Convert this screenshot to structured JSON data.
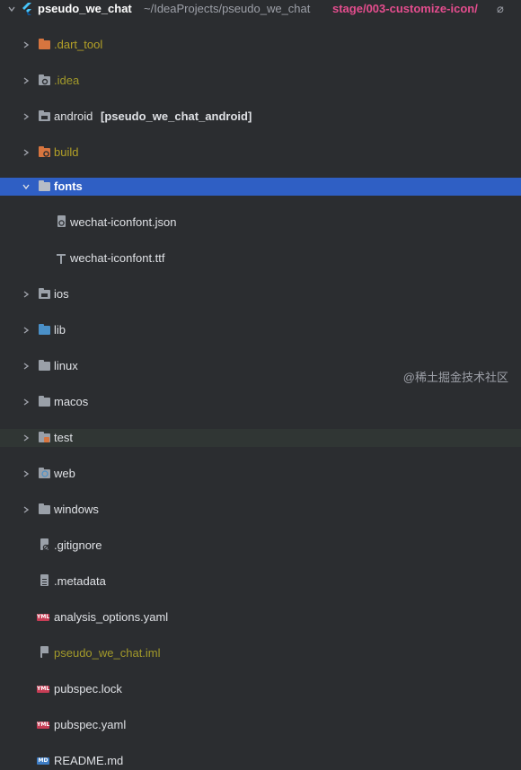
{
  "project": {
    "name": "pseudo_we_chat",
    "path": "~/IdeaProjects/pseudo_we_chat",
    "branch": "stage/003-customize-icon/",
    "branch_suffix": "⌀"
  },
  "tree": [
    {
      "label": "pseudo_we_chat"
    },
    {
      "label": ".dart_tool"
    },
    {
      "label": ".idea"
    },
    {
      "label": "android",
      "extra": "[pseudo_we_chat_android]"
    },
    {
      "label": "build"
    },
    {
      "label": "fonts"
    },
    {
      "label": "wechat-iconfont.json"
    },
    {
      "label": "wechat-iconfont.ttf"
    },
    {
      "label": "ios"
    },
    {
      "label": "lib"
    },
    {
      "label": "linux"
    },
    {
      "label": "macos"
    },
    {
      "label": "test"
    },
    {
      "label": "web"
    },
    {
      "label": "windows"
    },
    {
      "label": ".gitignore"
    },
    {
      "label": ".metadata"
    },
    {
      "label": "analysis_options.yaml"
    },
    {
      "label": "pseudo_we_chat.iml"
    },
    {
      "label": "pubspec.lock"
    },
    {
      "label": "pubspec.yaml"
    },
    {
      "label": "README.md"
    }
  ],
  "icons": {
    "yml": "YML",
    "md": "MD"
  },
  "watermark": "@稀土掘金技术社区"
}
